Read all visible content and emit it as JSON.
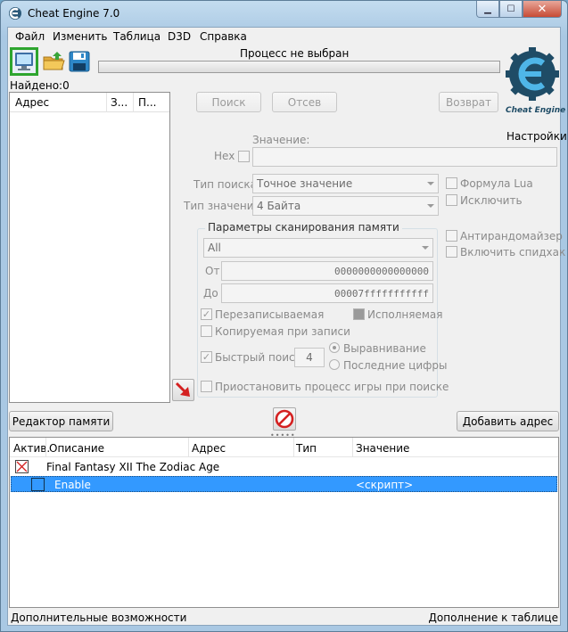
{
  "window": {
    "title": "Cheat Engine 7.0"
  },
  "menu": {
    "items": [
      "Файл",
      "Изменить",
      "Таблица",
      "D3D",
      "Справка"
    ]
  },
  "toolbar": {
    "process_label": "Процесс не выбран",
    "found_label": "Найдено:0"
  },
  "logo": {
    "text": "Cheat Engine"
  },
  "settings_label": "Настройки",
  "results": {
    "columns": [
      "Адрес",
      "З...",
      "П..."
    ]
  },
  "buttons": {
    "first_scan": "Поиск",
    "next_scan": "Отсев",
    "undo_scan": "Возврат",
    "memory_view": "Редактор памяти",
    "add_address": "Добавить адрес"
  },
  "value": {
    "label": "Значение:",
    "hex_label": "Hex",
    "value": "",
    "scan_type_label": "Тип поиска",
    "scan_type": "Точное значение",
    "value_type_label": "Тип значения",
    "value_type": "4 Байта"
  },
  "options": {
    "lua_formula": "Формула Lua",
    "not": "Исключить",
    "unrandomizer": "Антирандомайзер",
    "speedhack": "Включить спидхак"
  },
  "memory_scan": {
    "title": "Параметры сканирования памяти",
    "region": "All",
    "from_label": "От",
    "from": "0000000000000000",
    "to_label": "До",
    "to": "00007fffffffffff",
    "writable": "Перезаписываемая",
    "executable": "Исполняемая",
    "copy_on_write": "Копируемая при записи",
    "fast_scan": "Быстрый поиск",
    "fast_scan_value": "4",
    "alignment": "Выравнивание",
    "last_digits": "Последние цифры",
    "pause": "Приостановить процесс игры при поиске"
  },
  "table": {
    "columns": [
      "Актив.",
      "Описание",
      "Адрес",
      "Тип",
      "Значение"
    ],
    "rows": [
      {
        "description": "Final Fantasy XII The Zodiac Age",
        "address": "",
        "type": "",
        "value": ""
      },
      {
        "description": "Enable",
        "address": "",
        "type": "",
        "value": "<скрипт>"
      }
    ]
  },
  "status": {
    "left": "Дополнительные возможности",
    "right": "Дополнение к таблице"
  },
  "colors": {
    "selection": "#3399ff",
    "process_button_border": "#2ea52e",
    "stop_red": "#d42020"
  }
}
